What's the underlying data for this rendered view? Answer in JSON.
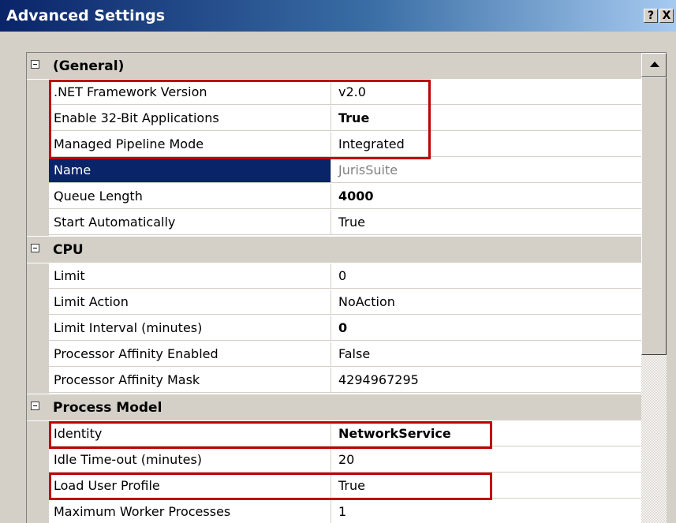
{
  "window": {
    "title": "Advanced Settings",
    "help_label": "?",
    "close_label": "X"
  },
  "grid": {
    "categories": [
      {
        "label": "(General)",
        "rows": [
          {
            "name": ".NET Framework Version",
            "value": "v2.0"
          },
          {
            "name": "Enable 32-Bit Applications",
            "value": "True"
          },
          {
            "name": "Managed Pipeline Mode",
            "value": "Integrated"
          },
          {
            "name": "Name",
            "value": "JurisSuite"
          },
          {
            "name": "Queue Length",
            "value": "4000"
          },
          {
            "name": "Start Automatically",
            "value": "True"
          }
        ]
      },
      {
        "label": "CPU",
        "rows": [
          {
            "name": "Limit",
            "value": "0"
          },
          {
            "name": "Limit Action",
            "value": "NoAction"
          },
          {
            "name": "Limit Interval (minutes)",
            "value": "0"
          },
          {
            "name": "Processor Affinity Enabled",
            "value": "False"
          },
          {
            "name": "Processor Affinity Mask",
            "value": "4294967295"
          }
        ]
      },
      {
        "label": "Process Model",
        "rows": [
          {
            "name": "Identity",
            "value": "NetworkService"
          },
          {
            "name": "Idle Time-out (minutes)",
            "value": "20"
          },
          {
            "name": "Load User Profile",
            "value": "True"
          },
          {
            "name": "Maximum Worker Processes",
            "value": "1"
          }
        ]
      }
    ]
  },
  "colors": {
    "highlight_box": "#c00000",
    "selection": "#0a246a",
    "titlebar": "#0a246a"
  },
  "icons": {
    "expander": "minus-box-icon",
    "scroll_up": "arrow-up-icon"
  }
}
